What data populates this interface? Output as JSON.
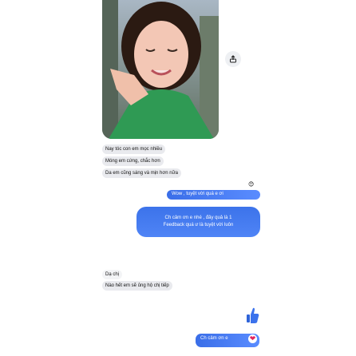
{
  "thread": {
    "photo_alt": "Selfie of a smiling woman in a green shirt",
    "share_icon": "share-icon",
    "messages": [
      {
        "side": "in",
        "text": "Nay tóc con em mọc nhiều"
      },
      {
        "side": "in",
        "text": "Móng em cứng, chắc hơn"
      },
      {
        "side": "in",
        "text": "Da em cũng sáng và mịn hơn nữa"
      },
      {
        "side": "out",
        "text": "Wow , tuyệt vời quá e ơi"
      },
      {
        "side": "out",
        "line1": "Ch cảm ơn e nhé , đây quả là 1",
        "line2": "Feedback quá ư là tuyệt vời luôn"
      },
      {
        "side": "in",
        "text": "Dạ chị"
      },
      {
        "side": "in",
        "text": "Nào hết em sẽ ủng hộ chị tiếp"
      },
      {
        "side": "out",
        "text": "Ch cảm ơn e"
      }
    ],
    "reaction_emoji": "😊",
    "heart": "❤",
    "thumbs_up": "👍"
  },
  "colors": {
    "incoming_bubble": "#e9eaee",
    "outgoing_bubble": "#3a6ee8",
    "heart": "#e0245e"
  }
}
